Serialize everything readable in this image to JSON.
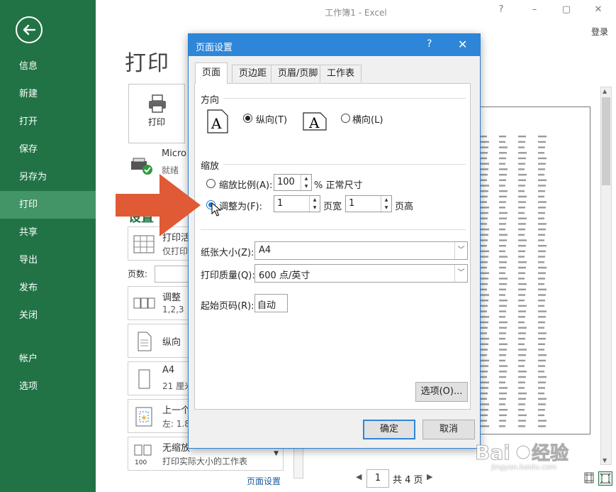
{
  "window": {
    "title": "工作簿1 - Excel",
    "login": "登录",
    "help": "?",
    "minimize": "–",
    "restore": "▢",
    "close": "✕"
  },
  "nav": {
    "items": [
      {
        "label": "信息"
      },
      {
        "label": "新建"
      },
      {
        "label": "打开"
      },
      {
        "label": "保存"
      },
      {
        "label": "另存为"
      },
      {
        "label": "打印",
        "active": true
      },
      {
        "label": "共享"
      },
      {
        "label": "导出"
      },
      {
        "label": "发布"
      },
      {
        "label": "关闭"
      },
      {
        "label": "帐户"
      },
      {
        "label": "选项"
      }
    ]
  },
  "print": {
    "title": "打印",
    "print_button": "打印",
    "printer_name": "Micro",
    "printer_status": "就绪",
    "settings_heading": "设置",
    "cards": [
      {
        "line1": "打印活",
        "line2": "仅打印"
      },
      {
        "line1": "调整",
        "line2": "1,2,3"
      },
      {
        "line1": "纵向",
        "line2": ""
      },
      {
        "line1": "A4",
        "line2": "21 厘米"
      },
      {
        "line1": "上一个",
        "line2": "左: 1.8"
      },
      {
        "line1": "无缩放",
        "line2": "打印实际大小的工作表"
      }
    ],
    "pages_label": "页数:",
    "page_setup_link": "页面设置",
    "pager": {
      "prev": "◀",
      "current": "1",
      "total": "共 4 页",
      "next": "▶"
    }
  },
  "dialog": {
    "title": "页面设置",
    "help": "?",
    "close": "✕",
    "tabs": [
      "页面",
      "页边距",
      "页眉/页脚",
      "工作表"
    ],
    "orientation": {
      "heading": "方向",
      "portrait_label": "纵向(T)",
      "landscape_label": "横向(L)",
      "selected": "portrait"
    },
    "scaling": {
      "heading": "缩放",
      "adjust_label": "缩放比例(A):",
      "adjust_value": "100",
      "adjust_suffix": "% 正常尺寸",
      "fit_label": "调整为(F):",
      "fit_wide_value": "1",
      "fit_wide_label": "页宽",
      "fit_tall_value": "1",
      "fit_tall_label": "页高",
      "selected": "fit"
    },
    "paper_size_label": "纸张大小(Z):",
    "paper_size_value": "A4",
    "print_quality_label": "打印质量(Q):",
    "print_quality_value": "600 点/英寸",
    "first_page_label": "起始页码(R):",
    "first_page_value": "自动",
    "options_button": "选项(O)...",
    "ok_button": "确定",
    "cancel_button": "取消"
  },
  "watermark": {
    "brand": "Baidu经验",
    "url": "jingyan.baidu.com"
  },
  "colors": {
    "nav_bg": "#217346",
    "nav_active": "#439467",
    "dialog_title": "#2e86d8",
    "arrow": "#e05a35"
  }
}
